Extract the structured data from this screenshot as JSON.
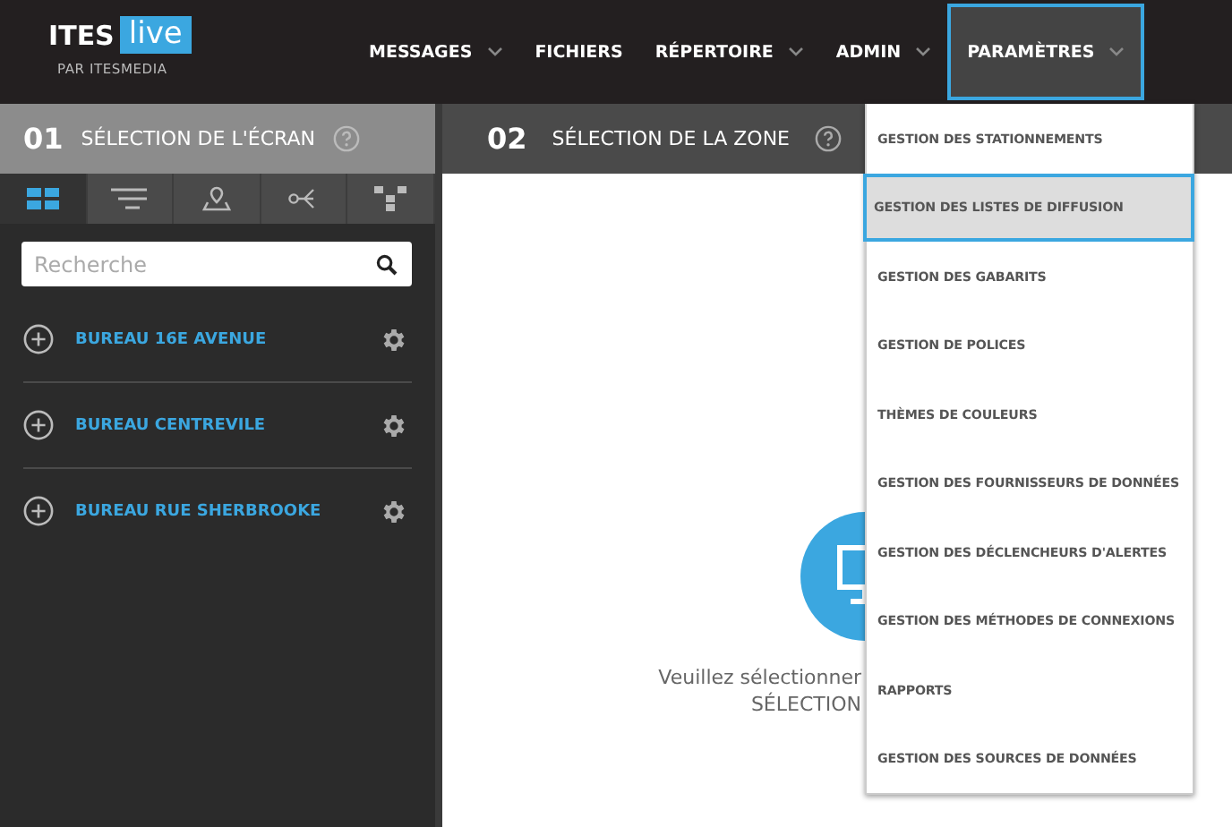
{
  "logo": {
    "brand": "ITES",
    "badge": "live",
    "tagline": "PAR ITESMEDIA"
  },
  "nav": [
    {
      "label": "MESSAGES",
      "dropdown": true,
      "selected": false
    },
    {
      "label": "FICHIERS",
      "dropdown": false,
      "selected": false
    },
    {
      "label": "RÉPERTOIRE",
      "dropdown": true,
      "selected": false
    },
    {
      "label": "ADMIN",
      "dropdown": true,
      "selected": false
    },
    {
      "label": "PARAMÈTRES",
      "dropdown": true,
      "selected": true
    }
  ],
  "step1": {
    "number": "01",
    "title": "SÉLECTION DE L'ÉCRAN"
  },
  "step2": {
    "number": "02",
    "title": "SÉLECTION DE LA ZONE"
  },
  "view_tabs": [
    {
      "kind": "grid",
      "selected": true
    },
    {
      "kind": "filter",
      "selected": false
    },
    {
      "kind": "map",
      "selected": false
    },
    {
      "kind": "share",
      "selected": false
    },
    {
      "kind": "tree",
      "selected": false
    }
  ],
  "search": {
    "placeholder": "Recherche"
  },
  "groups": [
    {
      "name": "BUREAU 16E AVENUE"
    },
    {
      "name": "BUREAU CENTREVILE"
    },
    {
      "name": "BUREAU RUE SHERBROOKE"
    }
  ],
  "empty_state": {
    "line_1": "Veuillez sélectionner",
    "line_2": "SÉLECTION"
  },
  "menu": [
    {
      "label": "GESTION DES STATIONNEMENTS",
      "selected": false
    },
    {
      "label": "GESTION DES LISTES DE DIFFUSION",
      "selected": true
    },
    {
      "label": "GESTION DES GABARITS",
      "selected": false
    },
    {
      "label": "GESTION DE POLICES",
      "selected": false
    },
    {
      "label": "THÈMES DE COULEURS",
      "selected": false
    },
    {
      "label": "GESTION DES FOURNISSEURS DE DONNÉES",
      "selected": false
    },
    {
      "label": "GESTION DES DÉCLENCHEURS D'ALERTES",
      "selected": false
    },
    {
      "label": "GESTION DES MÉTHODES DE CONNEXIONS",
      "selected": false
    },
    {
      "label": "RAPPORTS",
      "selected": false
    },
    {
      "label": "GESTION DES SOURCES DE DONNÉES",
      "selected": false
    }
  ]
}
